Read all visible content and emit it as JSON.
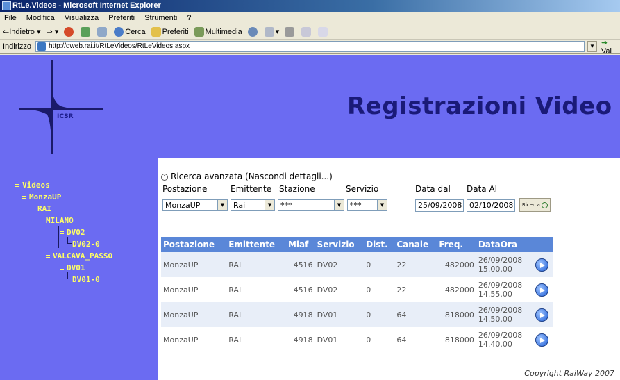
{
  "window": {
    "title": "RtLe.Videos - Microsoft Internet Explorer"
  },
  "menu": [
    "File",
    "Modifica",
    "Visualizza",
    "Preferiti",
    "Strumenti",
    "?"
  ],
  "toolbar": {
    "back": "Indietro",
    "search": "Cerca",
    "favorites": "Preferiti",
    "multimedia": "Multimedia"
  },
  "address": {
    "label": "Indirizzo",
    "url": "http://qweb.rai.it/RtLeVideos/RtLeVideos.aspx",
    "go": "Vai"
  },
  "header": {
    "logo_text": "ICSR",
    "title": "Registrazioni Video"
  },
  "tree": {
    "videos": "Videos",
    "monzaup": "MonzaUP",
    "rai": "RAI",
    "milano": "MILANO",
    "dv02": "DV02",
    "dv02_0": "DV02-0",
    "valcava": "VALCAVA_PASSO",
    "dv01": "DV01",
    "dv01_0": "DV01-0"
  },
  "search": {
    "toggle": "Ricerca avanzata (Nascondi dettagli...)",
    "labels": {
      "postazione": "Postazione",
      "emittente": "Emittente",
      "stazione": "Stazione",
      "servizio": "Servizio",
      "data_dal": "Data dal",
      "data_al": "Data Al"
    },
    "values": {
      "postazione": "MonzaUP",
      "emittente": "Rai",
      "stazione": "***",
      "servizio": "***",
      "data_dal": "25/09/2008",
      "data_al": "02/10/2008"
    },
    "button": "Ricerca"
  },
  "table": {
    "headers": [
      "Postazione",
      "Emittente",
      "Miaf",
      "Servizio",
      "Dist.",
      "Canale",
      "Freq.",
      "DataOra"
    ],
    "rows": [
      {
        "postazione": "MonzaUP",
        "emittente": "RAI",
        "miaf": "4516",
        "servizio": "DV02",
        "dist": "0",
        "canale": "22",
        "freq": "482000",
        "date": "26/09/2008",
        "time": "15.00.00"
      },
      {
        "postazione": "MonzaUP",
        "emittente": "RAI",
        "miaf": "4516",
        "servizio": "DV02",
        "dist": "0",
        "canale": "22",
        "freq": "482000",
        "date": "26/09/2008",
        "time": "14.55.00"
      },
      {
        "postazione": "MonzaUP",
        "emittente": "RAI",
        "miaf": "4918",
        "servizio": "DV01",
        "dist": "0",
        "canale": "64",
        "freq": "818000",
        "date": "26/09/2008",
        "time": "14.50.00"
      },
      {
        "postazione": "MonzaUP",
        "emittente": "RAI",
        "miaf": "4918",
        "servizio": "DV01",
        "dist": "0",
        "canale": "64",
        "freq": "818000",
        "date": "26/09/2008",
        "time": "14.40.00"
      }
    ]
  },
  "footer": {
    "copyright": "Copyright RaiWay 2007"
  }
}
